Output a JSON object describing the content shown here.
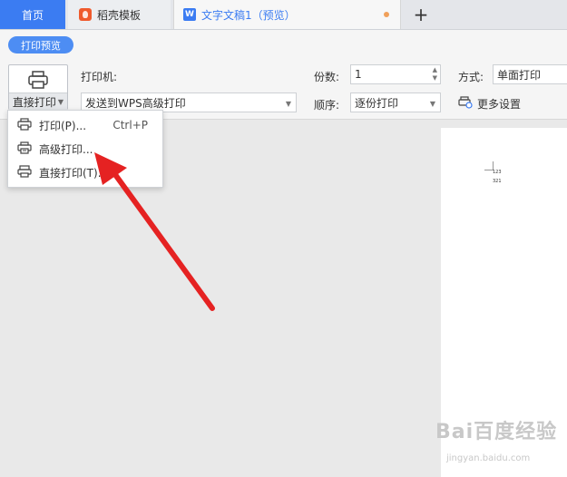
{
  "tabs": {
    "home": "首页",
    "template": "稻壳模板",
    "doc": "文字文稿1（预览）",
    "new": "+"
  },
  "toolbar": {
    "preview_label": "打印预览",
    "direct_print_label": "直接打印",
    "printer_label": "打印机:",
    "printer_value": "发送到WPS高级打印",
    "copies_label": "份数:",
    "copies_value": "1",
    "order_label": "顺序:",
    "order_value": "逐份打印",
    "mode_label": "方式:",
    "mode_value": "单面打印",
    "more_settings": "更多设置"
  },
  "menu": {
    "items": [
      {
        "label": "打印(P)...",
        "shortcut": "Ctrl+P"
      },
      {
        "label": "高级打印...",
        "shortcut": ""
      },
      {
        "label": "直接打印(T)...",
        "shortcut": ""
      }
    ]
  },
  "document": {
    "line1": "123",
    "line2": "321"
  },
  "watermark": {
    "brand": "Bai百度经验",
    "url": "jingyan.baidu.com"
  },
  "colors": {
    "accent": "#3b7cf2",
    "arrow": "#e52222",
    "modified_dot": "#f0a05a"
  }
}
